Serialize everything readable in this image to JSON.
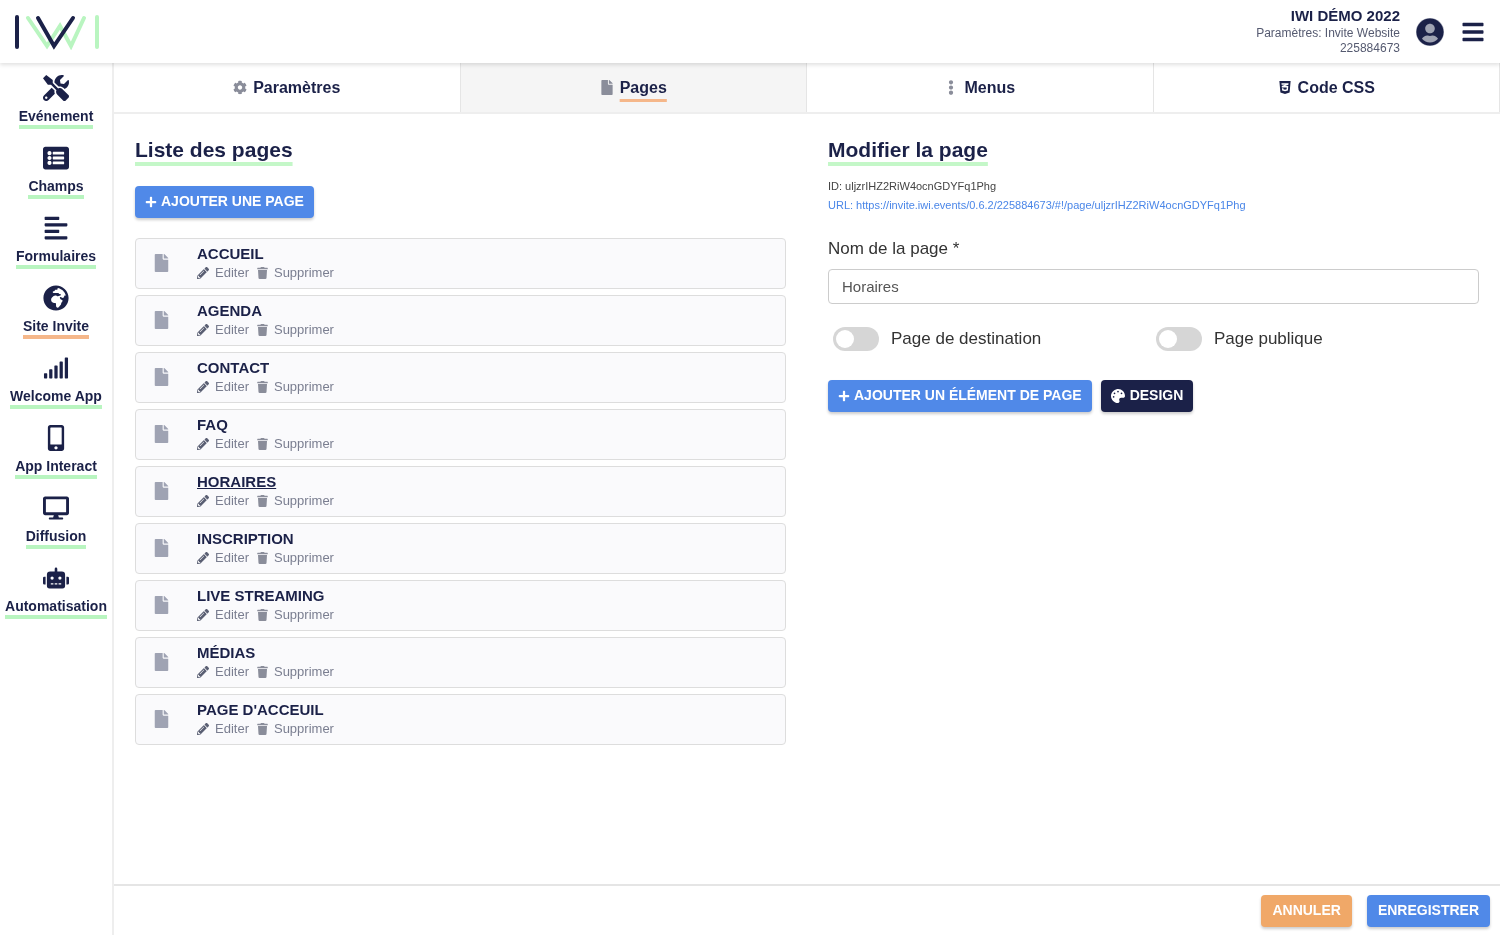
{
  "header": {
    "event_title": "IWI DÉMO 2022",
    "subtitle": "Paramètres: Invite Website",
    "event_id": "225884673"
  },
  "sidebar": {
    "items": [
      {
        "label": "Evénement",
        "selected": false
      },
      {
        "label": "Champs",
        "selected": false
      },
      {
        "label": "Formulaires",
        "selected": false
      },
      {
        "label": "Site Invite",
        "selected": true
      },
      {
        "label": "Welcome App",
        "selected": false
      },
      {
        "label": "App Interact",
        "selected": false
      },
      {
        "label": "Diffusion",
        "selected": false
      },
      {
        "label": "Automatisation",
        "selected": false
      }
    ]
  },
  "tabs": [
    {
      "label": "Paramètres",
      "selected": false
    },
    {
      "label": "Pages",
      "selected": true
    },
    {
      "label": "Menus",
      "selected": false
    },
    {
      "label": "Code CSS",
      "selected": false
    }
  ],
  "page_list": {
    "title": "Liste des pages",
    "add_button": "AJOUTER UNE PAGE",
    "pages": [
      {
        "name": "ACCUEIL",
        "selected": false,
        "edit_label": "Editer",
        "delete_label": "Supprimer"
      },
      {
        "name": "AGENDA",
        "selected": false,
        "edit_label": "Editer",
        "delete_label": "Supprimer"
      },
      {
        "name": "CONTACT",
        "selected": false,
        "edit_label": "Editer",
        "delete_label": "Supprimer"
      },
      {
        "name": "FAQ",
        "selected": false,
        "edit_label": "Editer",
        "delete_label": "Supprimer"
      },
      {
        "name": "HORAIRES",
        "selected": true,
        "edit_label": "Editer",
        "delete_label": "Supprimer"
      },
      {
        "name": "INSCRIPTION",
        "selected": false,
        "edit_label": "Editer",
        "delete_label": "Supprimer"
      },
      {
        "name": "LIVE STREAMING",
        "selected": false,
        "edit_label": "Editer",
        "delete_label": "Supprimer"
      },
      {
        "name": "MÉDIAS",
        "selected": false,
        "edit_label": "Editer",
        "delete_label": "Supprimer"
      },
      {
        "name": "PAGE D'ACCEUIL",
        "selected": false,
        "edit_label": "Editer",
        "delete_label": "Supprimer"
      }
    ]
  },
  "editor": {
    "title": "Modifier la page",
    "id_line": "ID: uljzrIHZ2RiW4ocnGDYFq1Phg",
    "url_line": "URL: https://invite.iwi.events/0.6.2/225884673/#!/page/uljzrIHZ2RiW4ocnGDYFq1Phg",
    "name_label": "Nom de la page *",
    "name_value": "Horaires",
    "toggles": [
      {
        "label": "Page de destination",
        "on": false
      },
      {
        "label": "Page publique",
        "on": false
      }
    ],
    "add_element_button": "AJOUTER UN ÉLÉMENT DE PAGE",
    "design_button": "DESIGN"
  },
  "footer": {
    "cancel_button": "ANNULER",
    "save_button": "ENREGISTRER"
  }
}
